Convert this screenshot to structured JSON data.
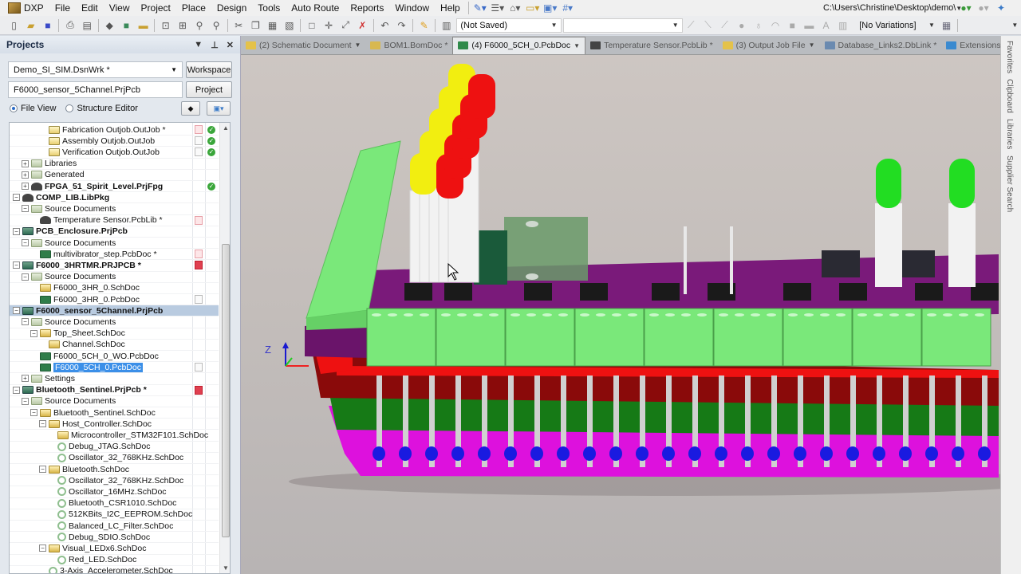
{
  "menubar": {
    "items": [
      "DXP",
      "File",
      "Edit",
      "View",
      "Project",
      "Place",
      "Design",
      "Tools",
      "Auto Route",
      "Reports",
      "Window",
      "Help"
    ],
    "path_combo": "C:\\Users\\Christine\\Desktop\\demo\\"
  },
  "toolbar": {
    "save_state": "(Not Saved)",
    "second_combo": "",
    "variations": "[No Variations]",
    "last_combo": ""
  },
  "projects_panel": {
    "title": "Projects",
    "workspace_value": "Demo_SI_SIM.DsnWrk *",
    "workspace_button": "Workspace",
    "project_value": "F6000_sensor_5Channel.PrjPcb",
    "project_button": "Project",
    "view_modes": [
      {
        "label": "File View",
        "selected": true
      },
      {
        "label": "Structure Editor",
        "selected": false
      }
    ],
    "tree": [
      {
        "label": "Fabrication Outjob.OutJob *",
        "level": 4,
        "icon": "out",
        "status": "pink",
        "ok": true
      },
      {
        "label": "Assembly Outjob.OutJob",
        "level": 4,
        "icon": "out",
        "status": "gray",
        "ok": true
      },
      {
        "label": "Verification Outjob.OutJob",
        "level": 4,
        "icon": "out",
        "status": "gray",
        "ok": true
      },
      {
        "label": "Libraries",
        "level": 2,
        "icon": "folder",
        "expander": "+"
      },
      {
        "label": "Generated",
        "level": 2,
        "icon": "folder",
        "expander": "+"
      },
      {
        "label": "FPGA_51_Spirit_Level.PrjFpg",
        "level": 2,
        "icon": "lib",
        "expander": "+",
        "bold": true,
        "ok": true
      },
      {
        "label": "COMP_LIB.LibPkg",
        "level": 1,
        "icon": "lib",
        "expander": "-",
        "bold": true
      },
      {
        "label": "Source Documents",
        "level": 2,
        "icon": "folder",
        "expander": "-"
      },
      {
        "label": "Temperature Sensor.PcbLib *",
        "level": 3,
        "icon": "lib",
        "status": "pink"
      },
      {
        "label": "PCB_Enclosure.PrjPcb",
        "level": 1,
        "icon": "prj",
        "expander": "-",
        "bold": true
      },
      {
        "label": "Source Documents",
        "level": 2,
        "icon": "folder",
        "expander": "-"
      },
      {
        "label": "multivibrator_step.PcbDoc *",
        "level": 3,
        "icon": "pcb",
        "status": "pink"
      },
      {
        "label": "F6000_3HRTMR.PRJPCB *",
        "level": 1,
        "icon": "prj",
        "expander": "-",
        "bold": true,
        "status": "red"
      },
      {
        "label": "Source Documents",
        "level": 2,
        "icon": "folder",
        "expander": "-"
      },
      {
        "label": "F6000_3HR_0.SchDoc",
        "level": 3,
        "icon": "sch"
      },
      {
        "label": "F6000_3HR_0.PcbDoc",
        "level": 3,
        "icon": "pcb",
        "status": "gray"
      },
      {
        "label": "F6000_sensor_5Channel.PrjPcb",
        "level": 1,
        "icon": "prj",
        "expander": "-",
        "bold": true,
        "selected": true
      },
      {
        "label": "Source Documents",
        "level": 2,
        "icon": "folder",
        "expander": "-"
      },
      {
        "label": "Top_Sheet.SchDoc",
        "level": 3,
        "icon": "sch",
        "expander": "-"
      },
      {
        "label": "Channel.SchDoc",
        "level": 4,
        "icon": "sch"
      },
      {
        "label": "F6000_5CH_0_WO.PcbDoc",
        "level": 3,
        "icon": "pcb"
      },
      {
        "label": "F6000_5CH_0.PcbDoc",
        "level": 3,
        "icon": "pcb",
        "highlight": true,
        "status": "gray"
      },
      {
        "label": "Settings",
        "level": 2,
        "icon": "folder",
        "expander": "+"
      },
      {
        "label": "Bluetooth_Sentinel.PrjPcb *",
        "level": 1,
        "icon": "prj",
        "expander": "-",
        "bold": true,
        "status": "red"
      },
      {
        "label": "Source Documents",
        "level": 2,
        "icon": "folder",
        "expander": "-"
      },
      {
        "label": "Bluetooth_Sentinel.SchDoc",
        "level": 3,
        "icon": "sch",
        "expander": "-"
      },
      {
        "label": "Host_Controller.SchDoc",
        "level": 4,
        "icon": "sch",
        "expander": "-"
      },
      {
        "label": "Microcontroller_STM32F101.SchDoc",
        "level": 5,
        "icon": "sch"
      },
      {
        "label": "Debug_JTAG.SchDoc",
        "level": 5,
        "icon": "recycle"
      },
      {
        "label": "Oscillator_32_768KHz.SchDoc",
        "level": 5,
        "icon": "recycle"
      },
      {
        "label": "Bluetooth.SchDoc",
        "level": 4,
        "icon": "sch",
        "expander": "-"
      },
      {
        "label": "Oscillator_32_768KHz.SchDoc",
        "level": 5,
        "icon": "recycle"
      },
      {
        "label": "Oscillator_16MHz.SchDoc",
        "level": 5,
        "icon": "recycle"
      },
      {
        "label": "Bluetooth_CSR1010.SchDoc",
        "level": 5,
        "icon": "recycle"
      },
      {
        "label": "512KBits_I2C_EEPROM.SchDoc",
        "level": 5,
        "icon": "recycle"
      },
      {
        "label": "Balanced_LC_Filter.SchDoc",
        "level": 5,
        "icon": "recycle"
      },
      {
        "label": "Debug_SDIO.SchDoc",
        "level": 5,
        "icon": "recycle"
      },
      {
        "label": "Visual_LEDx6.SchDoc",
        "level": 4,
        "icon": "sch",
        "expander": "-"
      },
      {
        "label": "Red_LED.SchDoc",
        "level": 5,
        "icon": "recycle"
      },
      {
        "label": "3-Axis_Accelerometer.SchDoc",
        "level": 4,
        "icon": "recycle"
      }
    ]
  },
  "document_tabs": [
    {
      "label": "(2) Schematic Document",
      "modified": false,
      "dropdown": true,
      "icon_color": "#e4c24a",
      "active": false
    },
    {
      "label": "BOM1.BomDoc *",
      "modified": true,
      "dropdown": false,
      "icon_color": "#d8b850",
      "active": false
    },
    {
      "label": "(4) F6000_5CH_0.PcbDoc",
      "modified": false,
      "dropdown": true,
      "icon_color": "#2f8a4a",
      "active": true
    },
    {
      "label": "Temperature Sensor.PcbLib *",
      "modified": true,
      "dropdown": false,
      "icon_color": "#444444",
      "active": false
    },
    {
      "label": "(3) Output Job File",
      "modified": false,
      "dropdown": true,
      "icon_color": "#e4c24a",
      "active": false
    },
    {
      "label": "Database_Links2.DbLink *",
      "modified": true,
      "dropdown": false,
      "icon_color": "#6a8ab0",
      "active": false
    },
    {
      "label": "Extensions",
      "modified": false,
      "dropdown": false,
      "icon_color": "#3a8ad0",
      "active": false
    }
  ],
  "tab_overflow": "»",
  "right_sidebar": [
    "Favorites",
    "Clipboard",
    "Libraries",
    "Supplier Search"
  ],
  "viewport": {
    "description": "3D PCB view",
    "axis_label": "Z",
    "colors": {
      "board_purple": "#7a1a7a",
      "terminal_green": "#7ae87a",
      "led_red": "#ee1111",
      "led_yellow": "#f2ee10",
      "led_green": "#22dd22",
      "layer_red": "#ee1111",
      "layer_darkred": "#8a0a0a",
      "layer_green": "#167a16",
      "layer_magenta": "#dd11dd",
      "pin_blue": "#1a1ae0"
    }
  }
}
